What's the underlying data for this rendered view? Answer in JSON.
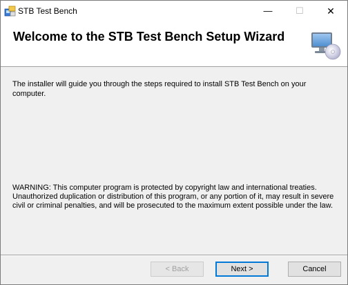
{
  "window": {
    "title": "STB Test Bench",
    "controls": {
      "minimize": "—",
      "maximize": "☐",
      "close": "✕"
    }
  },
  "header": {
    "title": "Welcome to the STB Test Bench Setup Wizard"
  },
  "body": {
    "description": "The installer will guide you through the steps required to install STB Test Bench on your computer.",
    "warning": "WARNING: This computer program is protected by copyright law and international treaties. Unauthorized duplication or distribution of this program, or any portion of it, may result in severe civil or criminal penalties, and will be prosecuted to the maximum extent possible under the law."
  },
  "buttons": {
    "back": "< Back",
    "next": "Next >",
    "cancel": "Cancel"
  },
  "icons": {
    "app": "installer-app-icon",
    "header": "computer-cd-icon"
  },
  "colors": {
    "accent": "#0078d7",
    "dialog_bg": "#f0f0f0"
  }
}
